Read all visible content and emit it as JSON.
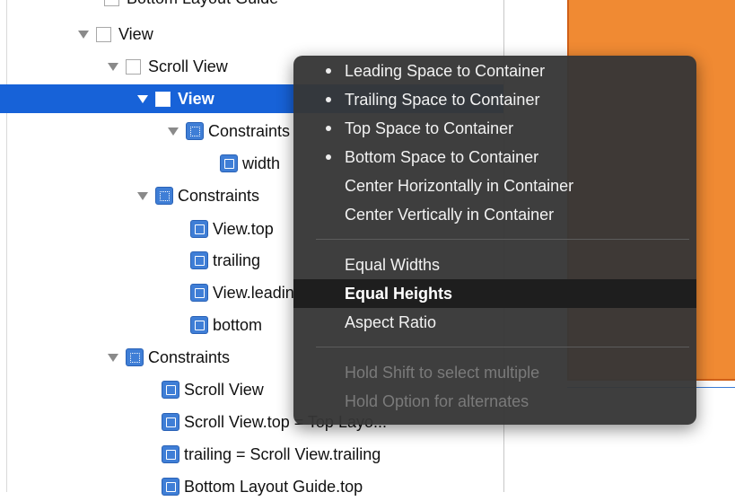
{
  "outline": {
    "rows": [
      {
        "label": "Bottom Layout Guide",
        "selected": false
      },
      {
        "label": "View",
        "selected": false
      },
      {
        "label": "Scroll View",
        "selected": false
      },
      {
        "label": "View",
        "selected": true
      },
      {
        "label": "Constraints",
        "selected": false
      },
      {
        "label": "width",
        "selected": false
      },
      {
        "label": "Constraints",
        "selected": false
      },
      {
        "label": "View.top",
        "selected": false
      },
      {
        "label": "trailing",
        "selected": false
      },
      {
        "label": "View.leading",
        "selected": false
      },
      {
        "label": "bottom",
        "selected": false
      },
      {
        "label": "Constraints",
        "selected": false
      },
      {
        "label": "Scroll View",
        "selected": false
      },
      {
        "label": "Scroll View.top = Top Layo...",
        "selected": false
      },
      {
        "label": "trailing = Scroll View.trailing",
        "selected": false
      },
      {
        "label": "Bottom Layout Guide.top",
        "selected": false
      }
    ]
  },
  "menu": {
    "items": [
      {
        "label": "Leading Space to Container",
        "bullet": true
      },
      {
        "label": "Trailing Space to Container",
        "bullet": true
      },
      {
        "label": "Top Space to Container",
        "bullet": true
      },
      {
        "label": "Bottom Space to Container",
        "bullet": true
      },
      {
        "label": "Center Horizontally in Container",
        "bullet": false
      },
      {
        "label": "Center Vertically in Container",
        "bullet": false
      },
      {
        "label": "Equal Widths",
        "bullet": false
      },
      {
        "label": "Equal Heights",
        "bullet": false,
        "highlighted": true
      },
      {
        "label": "Aspect Ratio",
        "bullet": false
      },
      {
        "label": "Hold Shift to select multiple",
        "disabled": true
      },
      {
        "label": "Hold Option for alternates",
        "disabled": true
      }
    ]
  },
  "colors": {
    "selection": "#1762d8",
    "canvas_view": "#f08a33",
    "constraint_icon": "#3f7ed6",
    "menu_bg": "#363636"
  }
}
